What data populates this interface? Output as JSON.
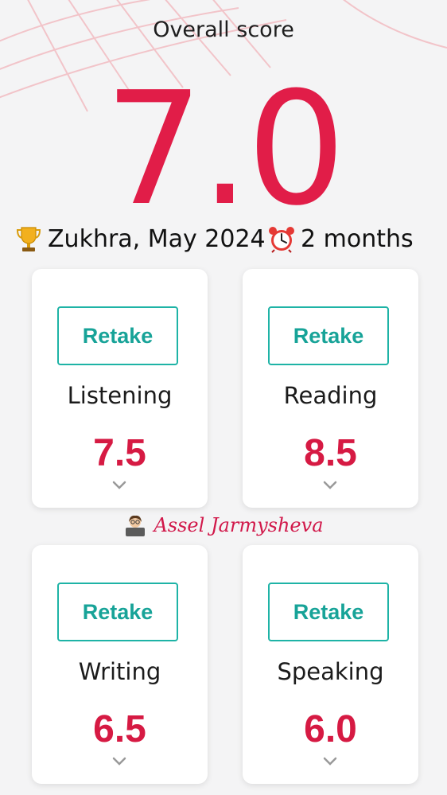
{
  "header": {
    "title": "Overall score",
    "overall_score": "7.0"
  },
  "caption": {
    "student": "Zukhra, May 2024",
    "duration": "2 months"
  },
  "author": "Assel Jarmysheva",
  "skills": [
    {
      "retake_label": "Retake",
      "name": "Listening",
      "score": "7.5"
    },
    {
      "retake_label": "Retake",
      "name": "Reading",
      "score": "8.5"
    },
    {
      "retake_label": "Retake",
      "name": "Writing",
      "score": "6.5"
    },
    {
      "retake_label": "Retake",
      "name": "Speaking",
      "score": "6.0"
    }
  ],
  "colors": {
    "score_red": "#e11d48",
    "retake_teal": "#1eb3a6",
    "author_pink": "#d1184a"
  },
  "icons": [
    "trophy-icon",
    "alarm-clock-icon",
    "teacher-icon",
    "chevron-down-icon"
  ]
}
